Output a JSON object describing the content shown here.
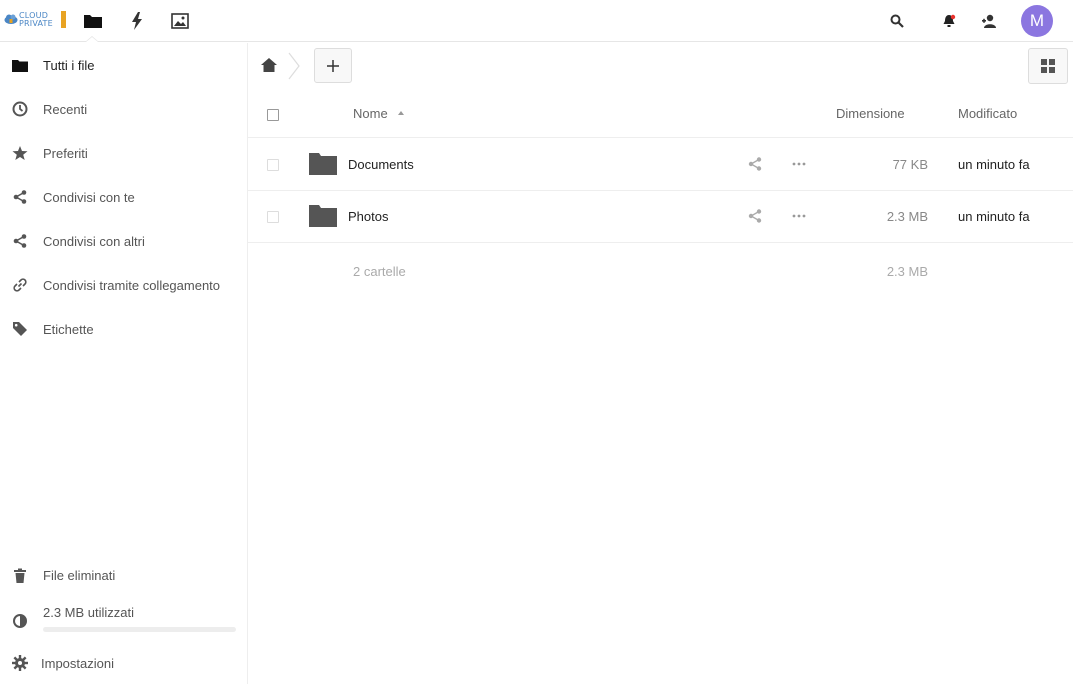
{
  "header": {
    "logo_line1": "CLOUD",
    "logo_line2": "PRIVATE",
    "avatar_initial": "M",
    "avatar_color": "#8b76e0"
  },
  "apps": [
    {
      "name": "files-app-icon"
    },
    {
      "name": "activity-app-icon"
    },
    {
      "name": "gallery-app-icon"
    }
  ],
  "sidebar": {
    "items": [
      {
        "label": "Tutti i file"
      },
      {
        "label": "Recenti"
      },
      {
        "label": "Preferiti"
      },
      {
        "label": "Condivisi con te"
      },
      {
        "label": "Condivisi con altri"
      },
      {
        "label": "Condivisi tramite collegamento"
      },
      {
        "label": "Etichette"
      }
    ],
    "trash_label": "File eliminati",
    "quota_label": "2.3 MB utilizzati",
    "quota_fraction": 0.0,
    "settings_label": "Impostazioni"
  },
  "table": {
    "col_name": "Nome",
    "col_size": "Dimensione",
    "col_modified": "Modificato",
    "rows": [
      {
        "name": "Documents",
        "size": "77 KB",
        "modified": "un minuto fa"
      },
      {
        "name": "Photos",
        "size": "2.3 MB",
        "modified": "un minuto fa"
      }
    ],
    "summary_count": "2 cartelle",
    "summary_size": "2.3 MB"
  }
}
